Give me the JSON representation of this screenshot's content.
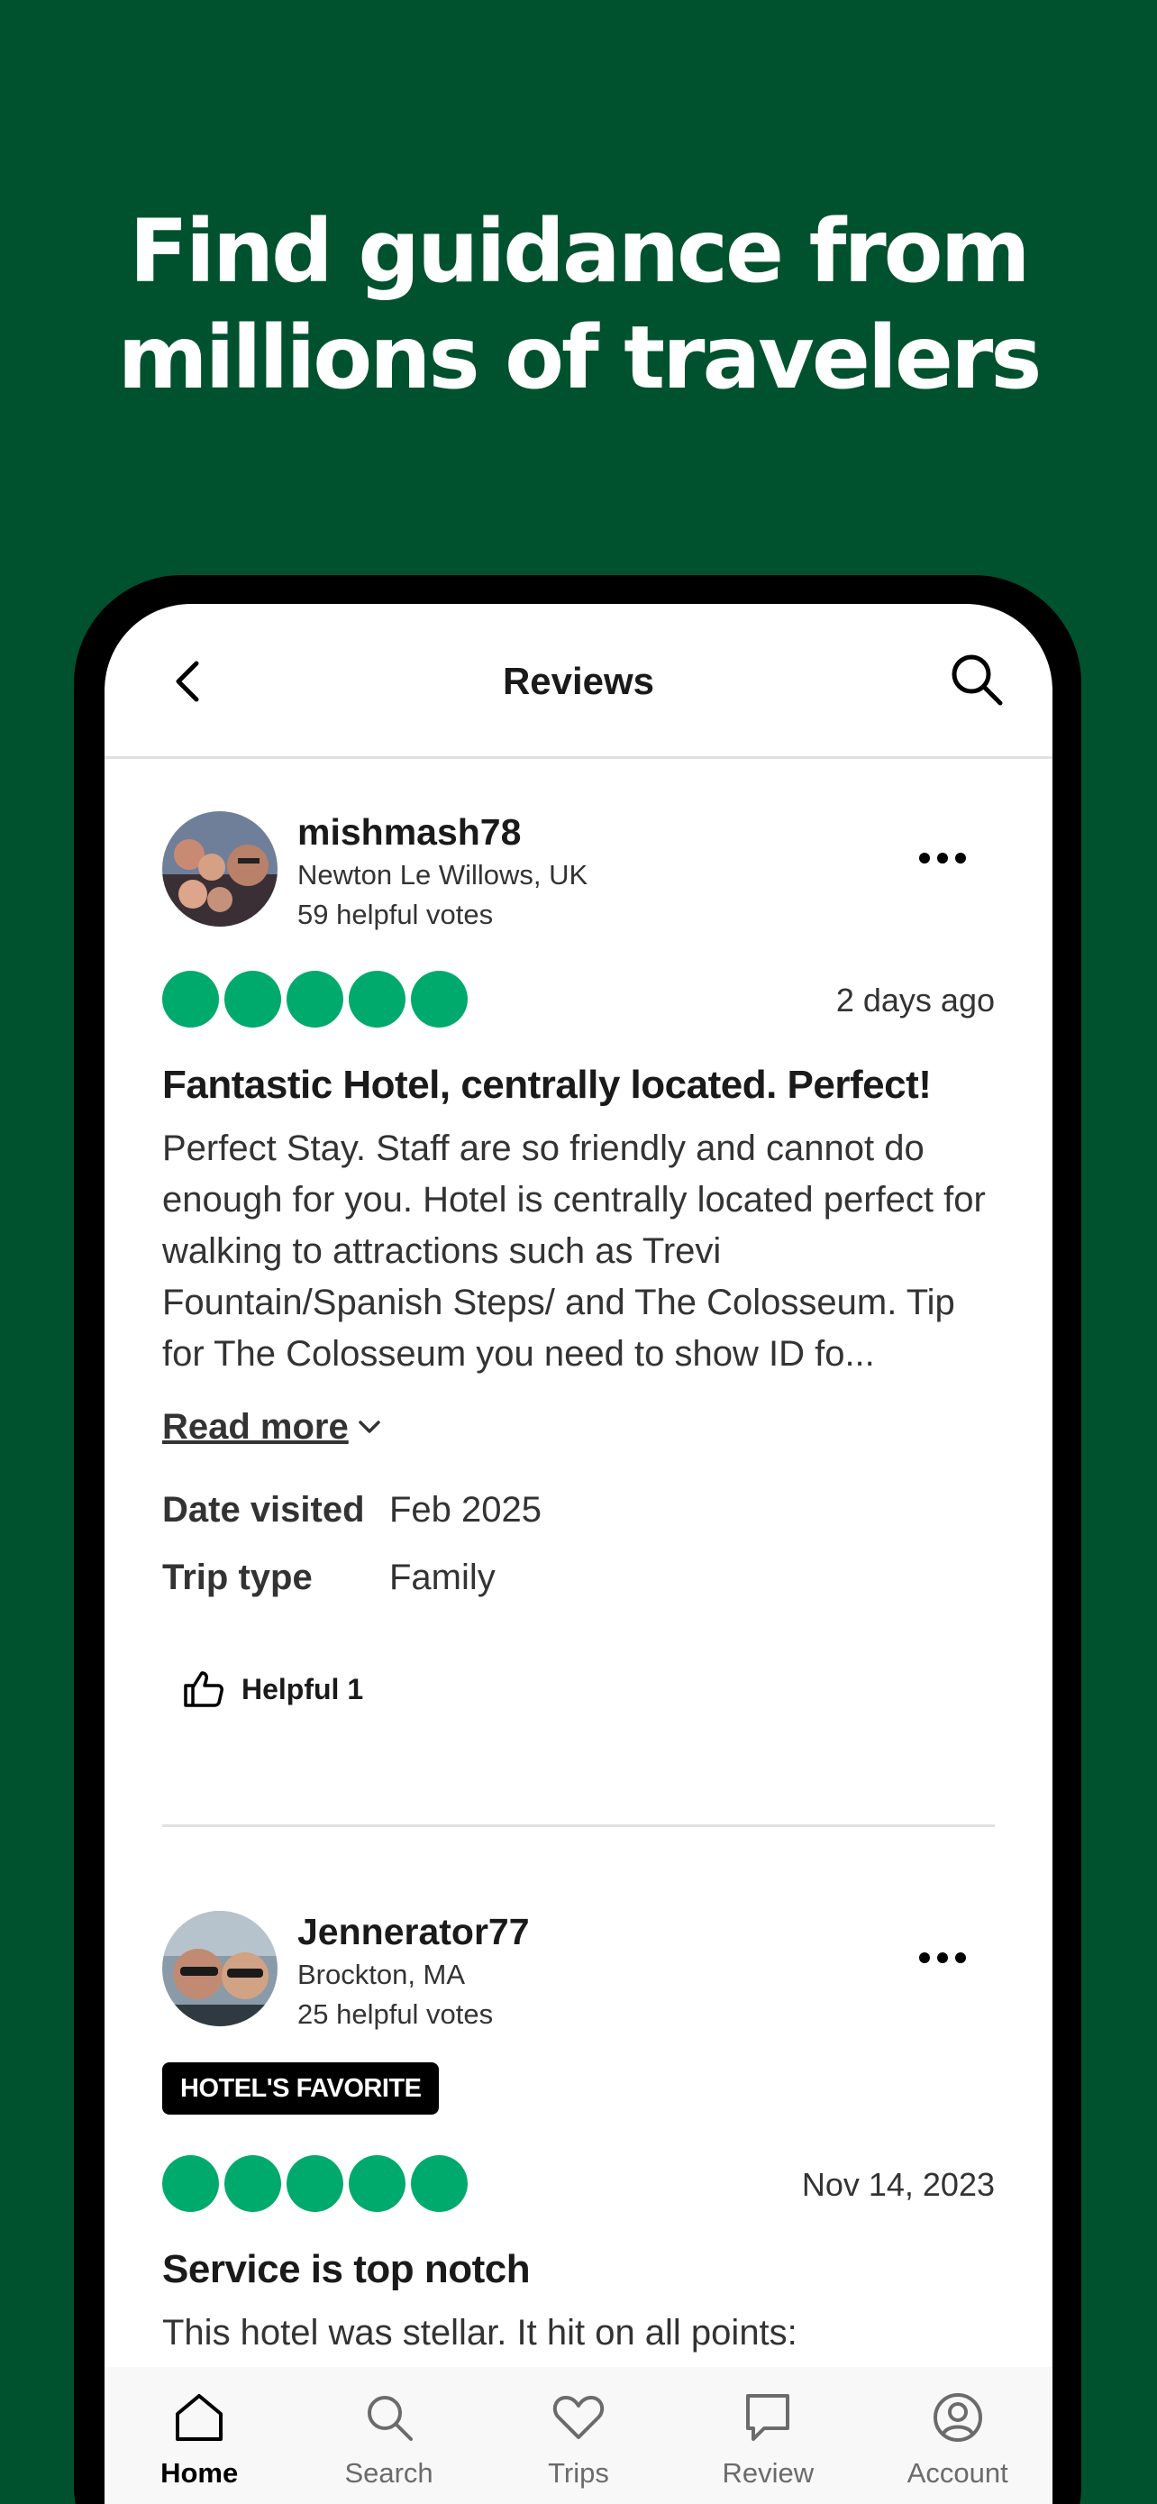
{
  "hero": {
    "line1": "Find guidance from",
    "line2": "millions of travelers"
  },
  "nav": {
    "title": "Reviews",
    "back_icon": "chevron-left-icon",
    "search_icon": "search-icon"
  },
  "reviews": [
    {
      "username": "mishmash78",
      "location": "Newton Le Willows, UK",
      "votes": "59 helpful votes",
      "rating": 5,
      "date": "2 days ago",
      "title": "Fantastic Hotel, centrally located. Perfect!",
      "body": "Perfect Stay. Staff are so friendly and cannot do enough for you. Hotel is centrally located perfect for walking to attractions such as Trevi Fountain/Spanish Steps/ and The Colosseum. Tip for The Colosseum you need to show ID fo...",
      "read_more": "Read more",
      "date_visited_label": "Date visited",
      "date_visited": "Feb 2025",
      "trip_type_label": "Trip type",
      "trip_type": "Family",
      "helpful": "Helpful 1"
    },
    {
      "username": "Jennerator77",
      "location": "Brockton, MA",
      "votes": "25 helpful votes",
      "badge": "HOTEL'S FAVORITE",
      "rating": 5,
      "date": "Nov 14, 2023",
      "title": "Service is top notch",
      "body": "This hotel was stellar. It hit on all points:"
    }
  ],
  "tabs": [
    {
      "label": "Home",
      "icon": "home-icon",
      "active": true
    },
    {
      "label": "Search",
      "icon": "search-icon",
      "active": false
    },
    {
      "label": "Trips",
      "icon": "heart-icon",
      "active": false
    },
    {
      "label": "Review",
      "icon": "speech-bubble-icon",
      "active": false
    },
    {
      "label": "Account",
      "icon": "account-icon",
      "active": false
    }
  ],
  "colors": {
    "brand_green": "#00522e",
    "rating_green": "#00aa6c"
  }
}
